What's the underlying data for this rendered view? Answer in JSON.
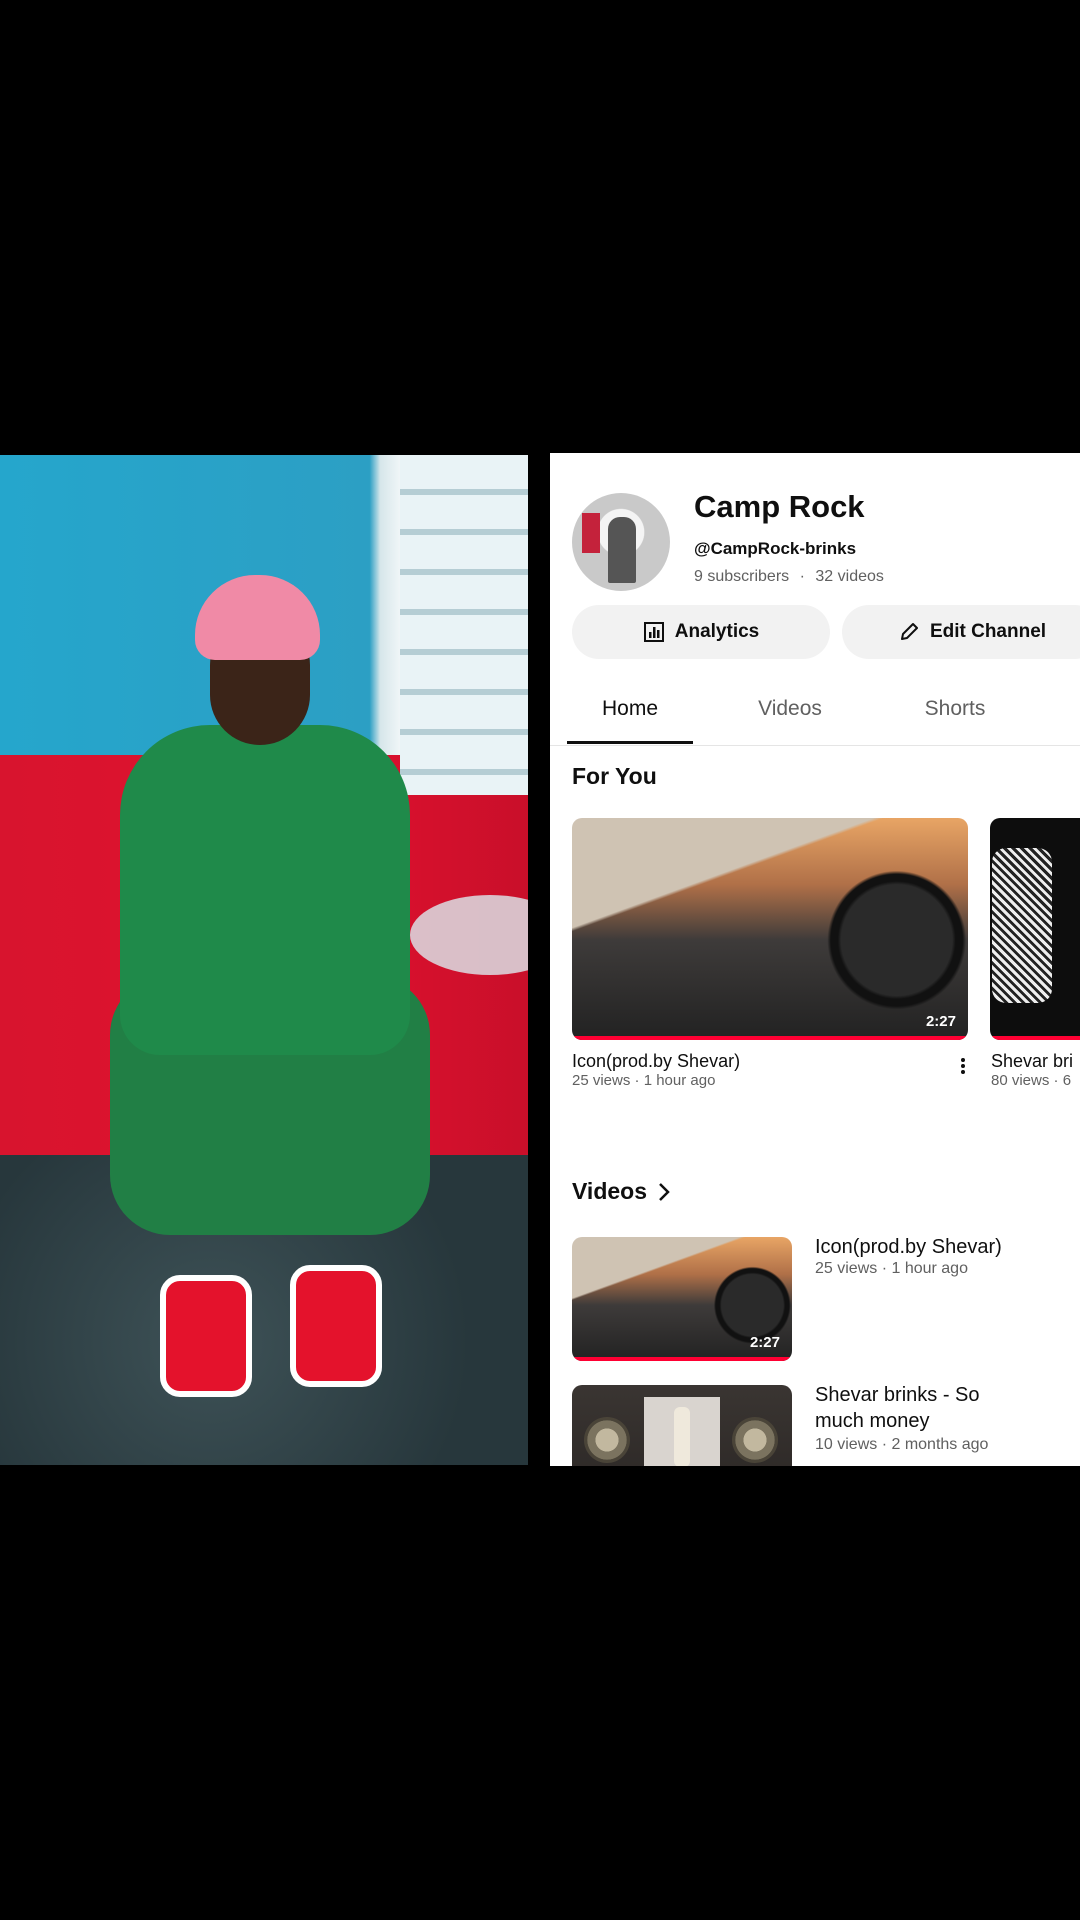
{
  "channel": {
    "name": "Camp Rock",
    "handle": "@CampRock-brinks",
    "subscribers": "9 subscribers",
    "separator": "·",
    "videos_count": "32 videos"
  },
  "buttons": {
    "analytics": "Analytics",
    "edit_channel": "Edit Channel"
  },
  "tabs": [
    {
      "label": "Home",
      "active": true
    },
    {
      "label": "Videos",
      "active": false
    },
    {
      "label": "Shorts",
      "active": false
    }
  ],
  "for_you": {
    "title": "For You",
    "items": [
      {
        "title": "Icon(prod.by Shevar)",
        "meta": "25 views · 1 hour ago",
        "duration": "2:27"
      },
      {
        "title": "Shevar bri",
        "meta": "80 views · 6"
      }
    ]
  },
  "videos_section": {
    "title": "Videos",
    "items": [
      {
        "title": "Icon(prod.by Shevar)",
        "meta": "25 views · 1 hour ago",
        "duration": "2:27"
      },
      {
        "title_line1": "Shevar brinks - So",
        "title_line2": "much money",
        "meta": "10 views · 2 months ago"
      }
    ]
  },
  "colors": {
    "progress": "#ff0033",
    "secondary_text": "#606060",
    "button_bg": "#f2f2f2"
  },
  "icons": [
    "analytics-icon",
    "pencil-icon",
    "chevron-right-icon",
    "more-vert-icon"
  ]
}
